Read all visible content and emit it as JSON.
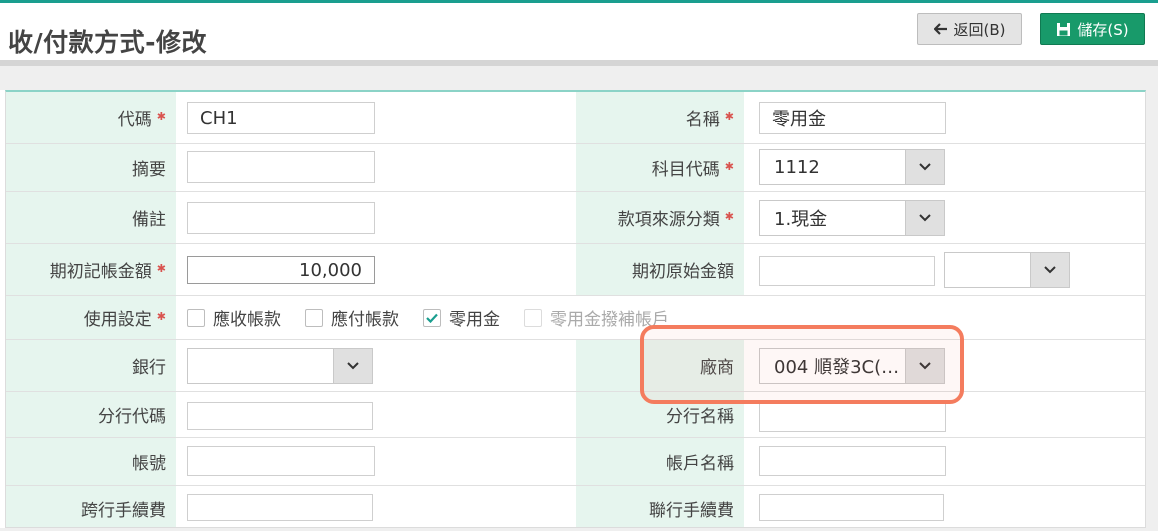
{
  "header": {
    "title": "收/付款方式-修改",
    "back_label": "返回(B)",
    "save_label": "儲存(S)"
  },
  "form": {
    "code": {
      "label": "代碼",
      "value": "CH1"
    },
    "name": {
      "label": "名稱",
      "value": "零用金"
    },
    "summary": {
      "label": "摘要",
      "value": ""
    },
    "subject_code": {
      "label": "科目代碼",
      "value": "1112"
    },
    "note": {
      "label": "備註",
      "value": ""
    },
    "source_category": {
      "label": "款項來源分類",
      "value": "1.現金"
    },
    "initial_amount": {
      "label": "期初記帳金額",
      "value": "10,000"
    },
    "initial_original_amount": {
      "label": "期初原始金額",
      "value": "",
      "currency": ""
    },
    "usage": {
      "label": "使用設定",
      "options": [
        {
          "label": "應收帳款",
          "checked": false,
          "disabled": false
        },
        {
          "label": "應付帳款",
          "checked": false,
          "disabled": false
        },
        {
          "label": "零用金",
          "checked": true,
          "disabled": false
        },
        {
          "label": "零用金撥補帳戶",
          "checked": false,
          "disabled": true
        }
      ]
    },
    "bank": {
      "label": "銀行",
      "value": ""
    },
    "vendor": {
      "label": "廠商",
      "value": "004 順發3C(…"
    },
    "branch_code": {
      "label": "分行代碼",
      "value": ""
    },
    "branch_name": {
      "label": "分行名稱",
      "value": ""
    },
    "account_no": {
      "label": "帳號",
      "value": ""
    },
    "account_name": {
      "label": "帳戶名稱",
      "value": ""
    },
    "interbank_fee": {
      "label": "跨行手續費",
      "value": ""
    },
    "joint_fee": {
      "label": "聯行手續費",
      "value": ""
    }
  },
  "colors": {
    "accent": "#1a9e8f",
    "save_button": "#189a6a",
    "label_bg": "#e6f5ee",
    "required": "#d9534f",
    "highlight": "#f47c5e"
  },
  "icons": {
    "back": "arrow-left-icon",
    "save": "floppy-disk-icon",
    "dropdown": "chevron-down-icon",
    "checked": "checkmark-icon"
  }
}
